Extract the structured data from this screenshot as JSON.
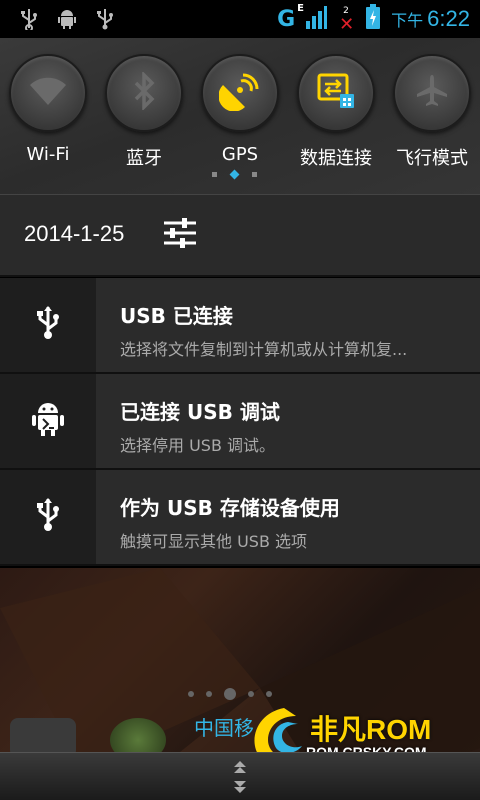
{
  "status_bar": {
    "left_icons": [
      "usb-icon",
      "android-debug-icon",
      "usb-icon"
    ],
    "network": "G",
    "network_sub": "E",
    "sim2_label": "2",
    "clock_period": "下午",
    "clock_time": "6:22"
  },
  "quick_settings": {
    "items": [
      {
        "label": "Wi-Fi",
        "icon": "wifi-icon",
        "active": false
      },
      {
        "label": "蓝牙",
        "icon": "bluetooth-icon",
        "active": false
      },
      {
        "label": "GPS",
        "icon": "gps-icon",
        "active": true
      },
      {
        "label": "数据连接",
        "icon": "data-connection-icon",
        "active": true
      },
      {
        "label": "飞行模式",
        "icon": "airplane-icon",
        "active": false
      }
    ],
    "page_count": 3,
    "current_page": 2
  },
  "date_row": {
    "date": "2014-1-25",
    "settings_icon": "settings-sliders-icon"
  },
  "notifications": [
    {
      "icon": "usb-icon",
      "title": "USB 已连接",
      "subtitle": "选择将文件复制到计算机或从计算机复..."
    },
    {
      "icon": "android-debug-icon",
      "title": "已连接 USB 调试",
      "subtitle": "选择停用 USB 调试。"
    },
    {
      "icon": "usb-icon",
      "title": "作为 USB 存储设备使用",
      "subtitle": "触摸可显示其他 USB 选项"
    }
  ],
  "background": {
    "carrier_text": "中国移"
  },
  "watermark": {
    "name": "非凡ROM",
    "url": "ROM.CRSKY.COM"
  },
  "colors": {
    "accent": "#33b5e5",
    "gps_yellow": "#ffd400",
    "sim_error": "#e0202a"
  }
}
